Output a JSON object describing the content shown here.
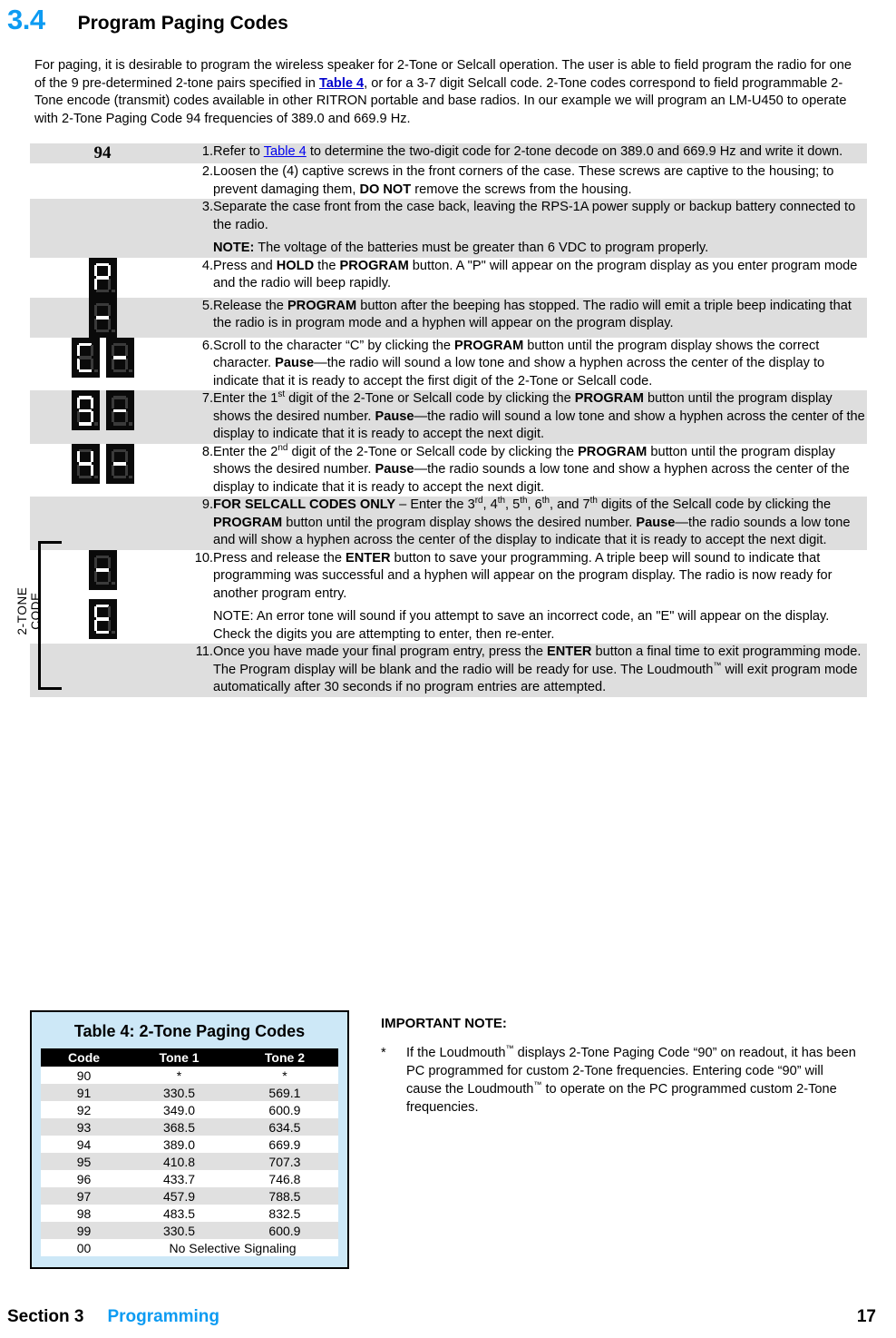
{
  "header": {
    "section_number": "3.4",
    "title": "Program Paging Codes"
  },
  "intro": {
    "part1": "For paging, it is desirable to program the wireless speaker for 2-Tone or Selcall operation. The user is able to field program the radio for one of the 9 pre-determined 2-tone pairs specified in ",
    "link_text": "Table 4",
    "part2": ", or for a 3-7 digit Selcall code. 2-Tone codes correspond to field programmable 2-Tone encode (transmit) codes available in other RITRON portable and base radios. In our example we will program an LM-U450 to operate with 2-Tone Paging Code 94 frequencies of 389.0 and 669.9 Hz."
  },
  "steps_table": {
    "code_cell": "94",
    "tone_bracket_label": "2-TONE\nCODE",
    "steps": [
      {
        "number": "1.",
        "display": "94",
        "text_pre": "Refer to ",
        "link": "Table 4",
        "text_post": " to determine the two-digit code for 2-tone decode on 389.0 and 669.9 Hz and write it down."
      },
      {
        "number": "2.",
        "text_a": "Loosen the (4) captive screws in the front corners of the case. These screws are captive to the housing; to prevent damaging them, ",
        "bold": "DO NOT",
        "text_b": " remove the screws from the housing."
      },
      {
        "number": "3.",
        "text_a": "Separate the case front from the case back, leaving the RPS-1A power supply or backup battery connected to the radio.",
        "note_label": "NOTE:",
        "note_text": "  The voltage of the batteries must be greater than 6 VDC to program properly."
      },
      {
        "number": "4.",
        "seg_chars": [
          "P"
        ],
        "text_a": "Press and ",
        "bold1": "HOLD",
        "text_b": " the ",
        "bold2": "PROGRAM",
        "text_c": " button. A \"P\" will appear on the program display as you enter program mode and the radio will beep rapidly."
      },
      {
        "number": "5.",
        "seg_chars": [
          "-"
        ],
        "text_a": "Release the ",
        "bold1": "PROGRAM",
        "text_b": " button after the beeping has stopped. The radio will emit a triple beep indicating that the radio is in program mode and a hyphen will appear on the program display."
      },
      {
        "number": "6.",
        "seg_chars": [
          "C",
          "-"
        ],
        "text_a": "Scroll to the character “C” by clicking the ",
        "bold1": "PROGRAM",
        "text_b": " button until the program display shows the correct character. ",
        "bold2": "Pause",
        "text_c": "—the radio will sound a low tone and show a hyphen across the center of the display to indicate that it is ready to accept the first digit of the 2-Tone or Selcall code."
      },
      {
        "number": "7.",
        "seg_chars": [
          "9",
          "-"
        ],
        "text_a": "Enter the 1",
        "sup1": "st",
        "text_b": " digit of the 2-Tone or Selcall code by clicking the ",
        "bold1": "PROGRAM",
        "text_c": " button until the program display shows the desired number. ",
        "bold2": "Pause",
        "text_d": "—the radio will sound a low tone and show a hyphen across the center of the display to indicate that it is ready to accept the next digit."
      },
      {
        "number": "8.",
        "seg_chars": [
          "4",
          "-"
        ],
        "text_a": "Enter the 2",
        "sup1": "nd",
        "text_b": " digit of the 2-Tone or Selcall code by clicking the ",
        "bold1": "PROGRAM",
        "text_c": " button until the program display shows the desired number.  ",
        "bold2": "Pause",
        "text_d": "—the radio sounds a low tone and show a hyphen across the center of the display to indicate that it is ready to accept the next digit."
      },
      {
        "number": "9.",
        "bold1": "FOR SELCALL CODES ONLY",
        "text_a": " – Enter the 3",
        "sup1": "rd",
        "text_b": ", 4",
        "sup2": "th",
        "text_c": ", 5",
        "sup3": "th",
        "text_d": ", 6",
        "sup4": "th",
        "text_e": ", and 7",
        "sup5": "th",
        "text_f": " digits of the Selcall code by clicking the ",
        "bold2": "PROGRAM",
        "text_g": " button until the program display shows the desired number. ",
        "bold3": "Pause",
        "text_h": "—the radio sounds a low tone and will show a hyphen across the center of the display to indicate that it is ready to accept the next digit."
      },
      {
        "number": "10.",
        "seg_chars": [
          "-",
          "E"
        ],
        "text_a": "Press and release the ",
        "bold1": "ENTER",
        "text_b": " button to save your programming. A triple beep will sound to indicate that programming was successful and a hyphen will appear on the program display.  The radio is now ready for another program entry.",
        "note": "NOTE:  An error tone will sound if you attempt to save an incorrect code, an \"E\" will appear on the display.  Check the digits you are attempting to enter, then re-enter."
      },
      {
        "number": "11.",
        "text_a": "Once you have made your final program entry, press the ",
        "bold1": "ENTER",
        "text_b": " button a final time to exit programming mode.  The Program display will be blank and the radio will be ready for use. The Loudmouth",
        "tm": "™",
        "text_c": " will exit program mode automatically after 30 seconds if no program entries are attempted."
      }
    ]
  },
  "table4": {
    "title": "Table 4:  2-Tone Paging Codes",
    "columns": [
      "Code",
      "Tone 1",
      "Tone 2"
    ],
    "rows": [
      {
        "code": "90",
        "tone1": "*",
        "tone2": "*"
      },
      {
        "code": "91",
        "tone1": "330.5",
        "tone2": "569.1"
      },
      {
        "code": "92",
        "tone1": "349.0",
        "tone2": "600.9"
      },
      {
        "code": "93",
        "tone1": "368.5",
        "tone2": "634.5"
      },
      {
        "code": "94",
        "tone1": "389.0",
        "tone2": "669.9"
      },
      {
        "code": "95",
        "tone1": "410.8",
        "tone2": "707.3"
      },
      {
        "code": "96",
        "tone1": "433.7",
        "tone2": "746.8"
      },
      {
        "code": "97",
        "tone1": "457.9",
        "tone2": "788.5"
      },
      {
        "code": "98",
        "tone1": "483.5",
        "tone2": "832.5"
      },
      {
        "code": "99",
        "tone1": "330.5",
        "tone2": "600.9"
      }
    ],
    "last_row": {
      "code": "00",
      "spanned": "No Selective Signaling"
    }
  },
  "important_note": {
    "heading": "IMPORTANT NOTE:",
    "marker": "*",
    "text_a": "If the Loudmouth",
    "tm1": "™",
    "text_b": " displays 2-Tone Paging Code “90” on readout, it has been PC programmed for custom 2-Tone frequencies.  Entering code “90” will cause the Loudmouth",
    "tm2": "™",
    "text_c": " to operate on the PC programmed custom 2-Tone frequencies."
  },
  "footer": {
    "section": "Section 3",
    "chapter": "Programming",
    "page": "17"
  },
  "colors": {
    "accent_blue": "#0d9bf2",
    "link_blue": "#0000cc",
    "row_shade": "#dedede",
    "table4_bg": "#cde8f7",
    "segment_on": "#ffffff",
    "segment_off": "#3a3a3a",
    "segment_bg": "#0a0a0a"
  }
}
